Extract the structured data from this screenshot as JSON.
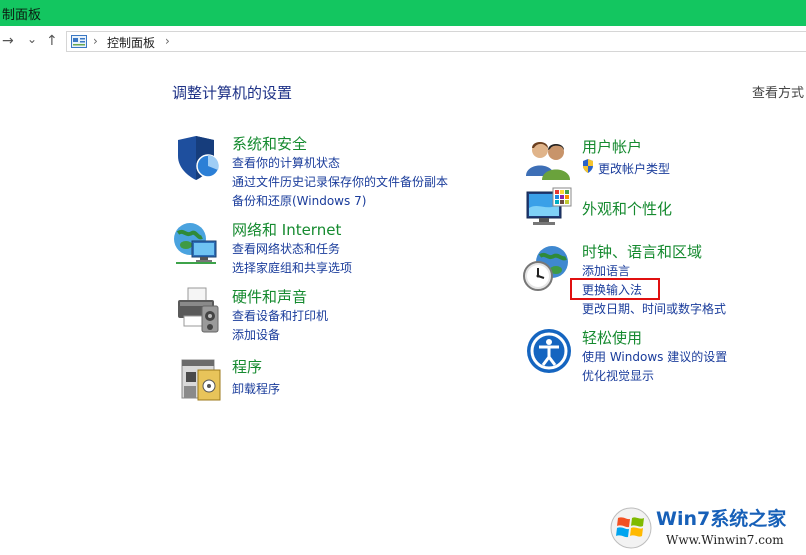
{
  "window": {
    "title": "制面板"
  },
  "address_bar": {
    "nav_forward": "→",
    "nav_dropdown": "⌄",
    "nav_up": "↑",
    "separator": "›",
    "path": "控制面板"
  },
  "main": {
    "title": "调整计算机的设置",
    "view_by": "查看方式"
  },
  "categories": {
    "system": {
      "title": "系统和安全",
      "icon": "shield-icon",
      "links": [
        "查看你的计算机状态",
        "通过文件历史记录保存你的文件备份副本",
        "备份和还原(Windows 7)"
      ]
    },
    "network": {
      "title": "网络和 Internet",
      "icon": "network-globe-icon",
      "links": [
        "查看网络状态和任务",
        "选择家庭组和共享选项"
      ]
    },
    "hardware": {
      "title": "硬件和声音",
      "icon": "printer-icon",
      "links": [
        "查看设备和打印机",
        "添加设备"
      ]
    },
    "programs": {
      "title": "程序",
      "icon": "programs-icon",
      "links": [
        "卸载程序"
      ]
    },
    "users": {
      "title": "用户帐户",
      "icon": "users-icon",
      "links": [
        "更改帐户类型"
      ]
    },
    "appearance": {
      "title": "外观和个性化",
      "icon": "monitor-palette-icon",
      "links": []
    },
    "clock": {
      "title": "时钟、语言和区域",
      "icon": "clock-globe-icon",
      "links": [
        "添加语言",
        "更换输入法",
        "更改日期、时间或数字格式"
      ]
    },
    "ease": {
      "title": "轻松使用",
      "icon": "ease-of-access-icon",
      "links": [
        "使用 Windows 建议的设置",
        "优化视觉显示"
      ]
    }
  },
  "watermark": {
    "brand": "Win7系统之家",
    "url": "Www.Winwin7.com"
  },
  "colors": {
    "titlebar": "#13c660",
    "category_title": "#158a2f",
    "link": "#1a3c9b",
    "highlight": "#e01010"
  }
}
